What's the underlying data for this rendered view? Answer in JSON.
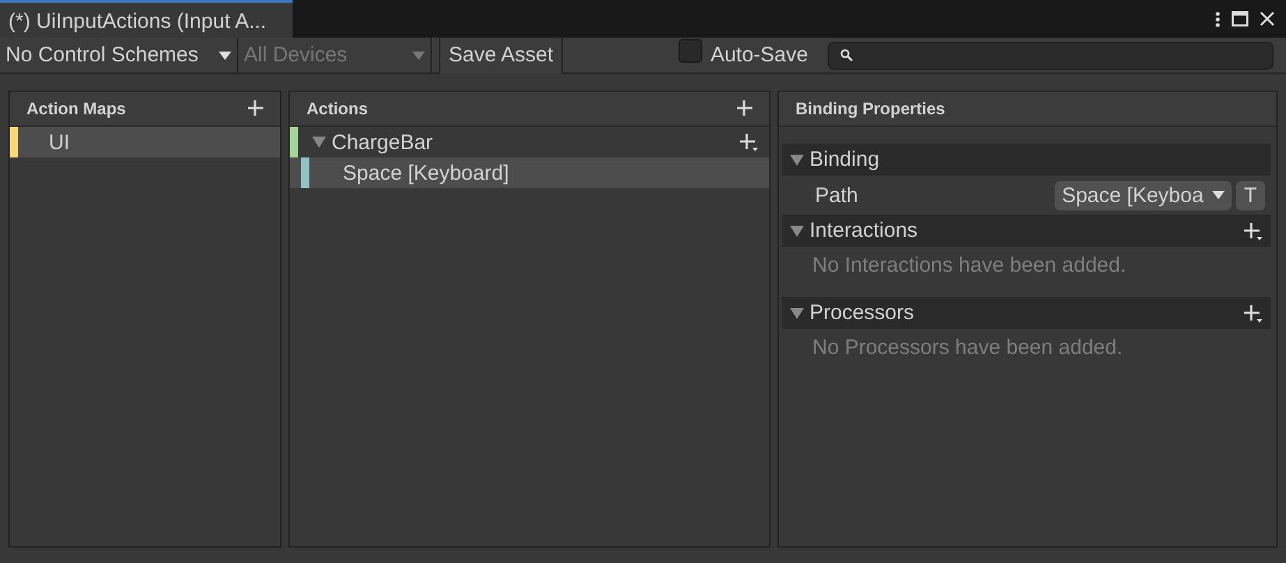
{
  "window": {
    "tab_title": "(*) UiInputActions (Input A..."
  },
  "toolbar": {
    "control_scheme": {
      "label": "No Control Schemes",
      "disabled": false
    },
    "devices": {
      "label": "All Devices",
      "disabled": true
    },
    "save_button": "Save Asset",
    "auto_save": {
      "label": "Auto-Save",
      "checked": false
    }
  },
  "action_maps": {
    "title": "Action Maps",
    "items": [
      {
        "label": "UI",
        "color": "#f8d77c",
        "selected": true
      }
    ]
  },
  "actions": {
    "title": "Actions",
    "items": [
      {
        "label": "ChargeBar",
        "color": "#a4d49a",
        "selected": false,
        "expanded": true,
        "children": [
          {
            "label": "Space [Keyboard]",
            "color": "#93c2c2",
            "selected": true
          }
        ]
      }
    ]
  },
  "binding_properties": {
    "title": "Binding Properties",
    "sections": [
      {
        "kind": "path",
        "title": "Binding",
        "expanded": true,
        "label": "Path",
        "value": "Space [Keyboa",
        "mode_button": "T"
      },
      {
        "kind": "list",
        "title": "Interactions",
        "expanded": true,
        "empty_text": "No Interactions have been added."
      },
      {
        "kind": "list",
        "title": "Processors",
        "expanded": true,
        "empty_text": "No Processors have been added."
      }
    ]
  }
}
